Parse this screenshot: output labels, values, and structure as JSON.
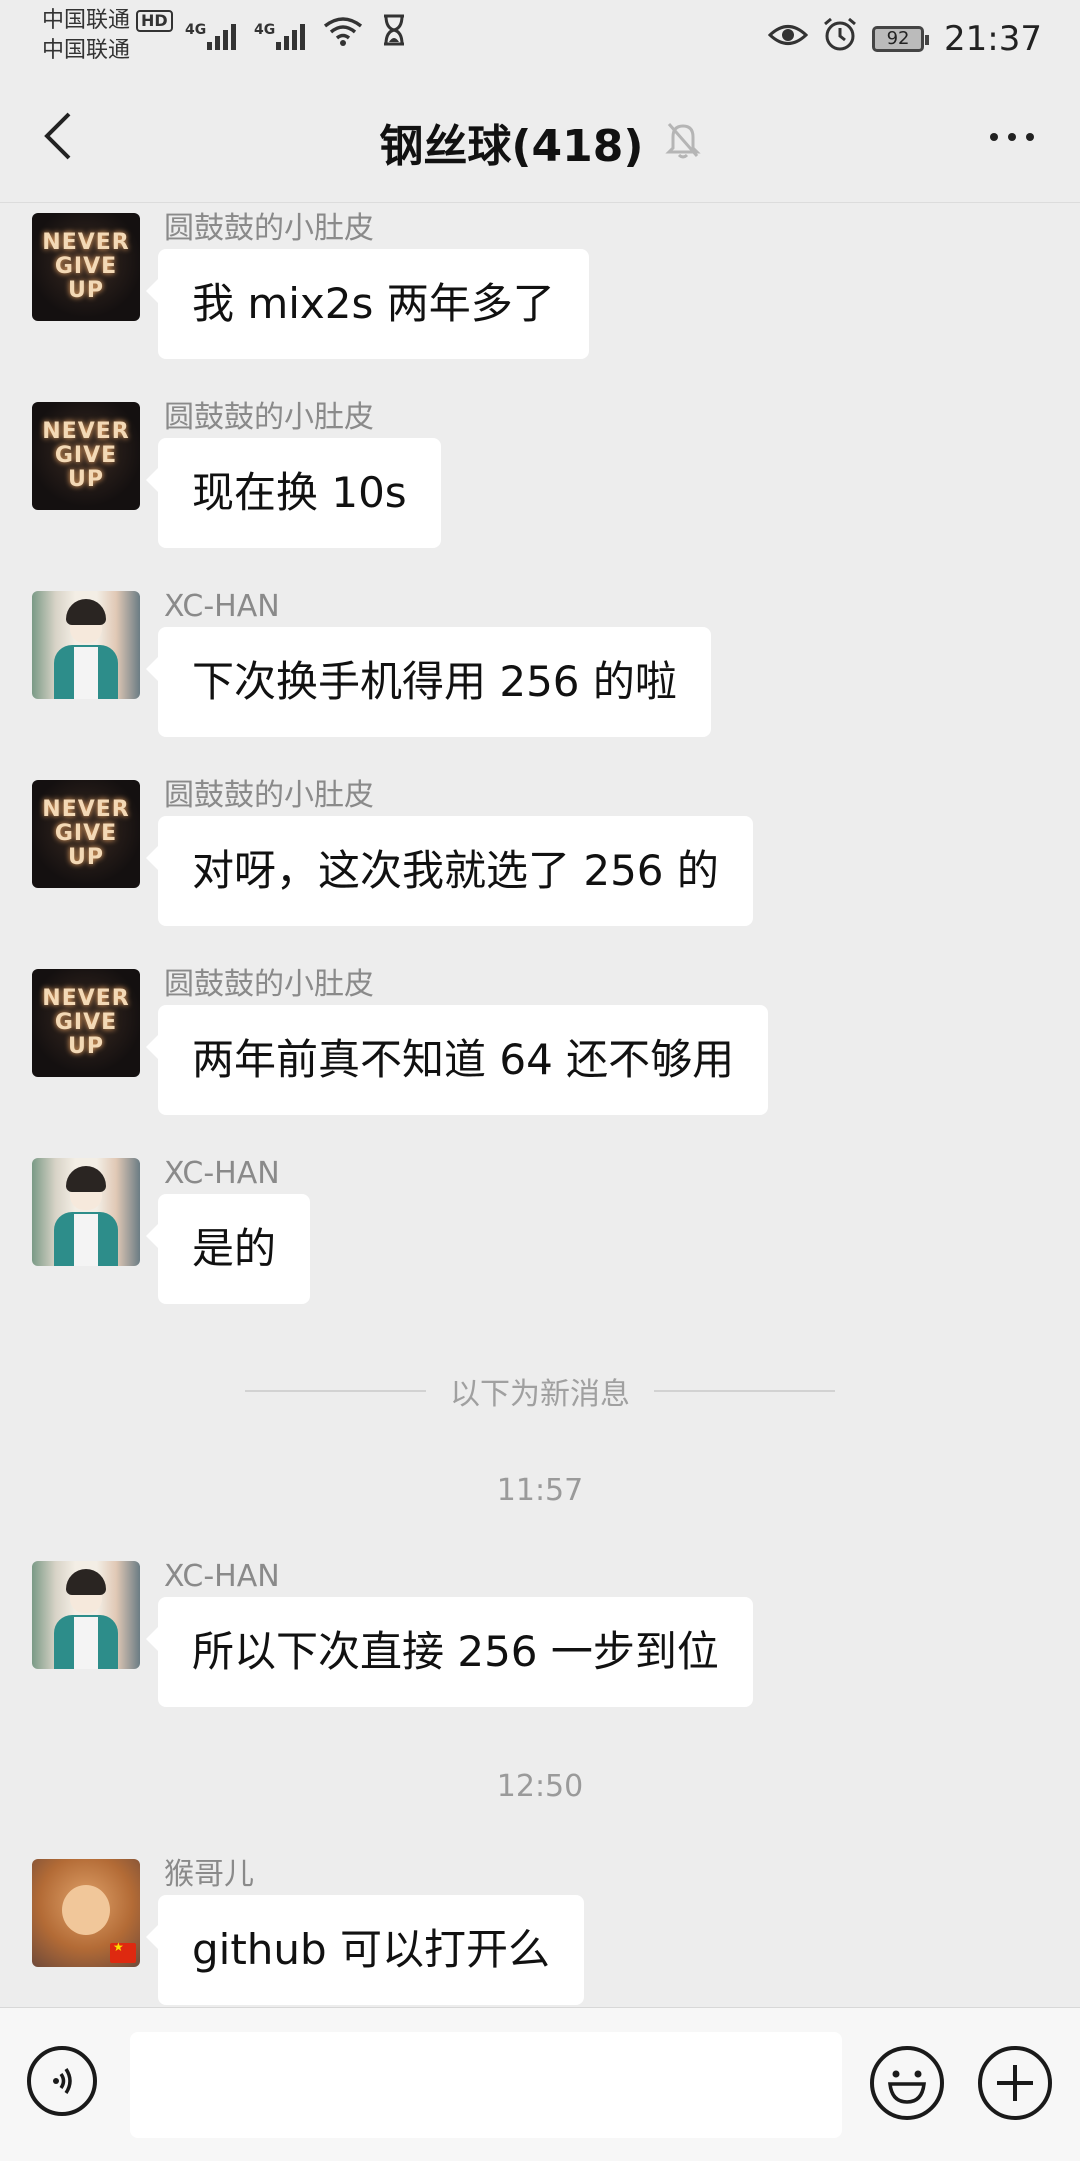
{
  "status_bar": {
    "carrier_1": "中国联通",
    "hd_badge": "HD",
    "carrier_2": "中国联通",
    "signal_1_label": "4G",
    "signal_2_label": "4G",
    "battery": "92",
    "time": "21:37",
    "icons": [
      "eye-icon",
      "alarm-icon",
      "battery-icon",
      "wifi-icon",
      "hourglass-icon"
    ]
  },
  "nav": {
    "title": "钢丝球(418)",
    "icons": [
      "back-icon",
      "mute-bell-icon",
      "more-icon"
    ]
  },
  "messages": [
    {
      "sender": "圆鼓鼓的小肚皮",
      "avatar": "never-give-up",
      "text": "我 mix2s 两年多了"
    },
    {
      "sender": "圆鼓鼓的小肚皮",
      "avatar": "never-give-up",
      "text": "现在换 10s"
    },
    {
      "sender": "XC-HAN",
      "avatar": "xc-han",
      "text": "下次换手机得用 256 的啦"
    },
    {
      "sender": "圆鼓鼓的小肚皮",
      "avatar": "never-give-up",
      "text": "对呀，这次我就选了 256 的"
    },
    {
      "sender": "圆鼓鼓的小肚皮",
      "avatar": "never-give-up",
      "text": "两年前真不知道 64 还不够用"
    },
    {
      "sender": "XC-HAN",
      "avatar": "xc-han",
      "text": "是的"
    },
    {
      "sender": "XC-HAN",
      "avatar": "xc-han",
      "text": "所以下次直接 256 一步到位"
    },
    {
      "sender": "猴哥儿",
      "avatar": "monkey",
      "text": "github 可以打开么"
    }
  ],
  "avatar_text": {
    "never_give_up": [
      "NEVER",
      "GIVE",
      "UP"
    ]
  },
  "divider_text": "以下为新消息",
  "timestamps": [
    "11:57",
    "12:50"
  ],
  "input_bar": {
    "placeholder": "",
    "icons": [
      "voice-icon",
      "emoji-icon",
      "plus-icon"
    ]
  }
}
